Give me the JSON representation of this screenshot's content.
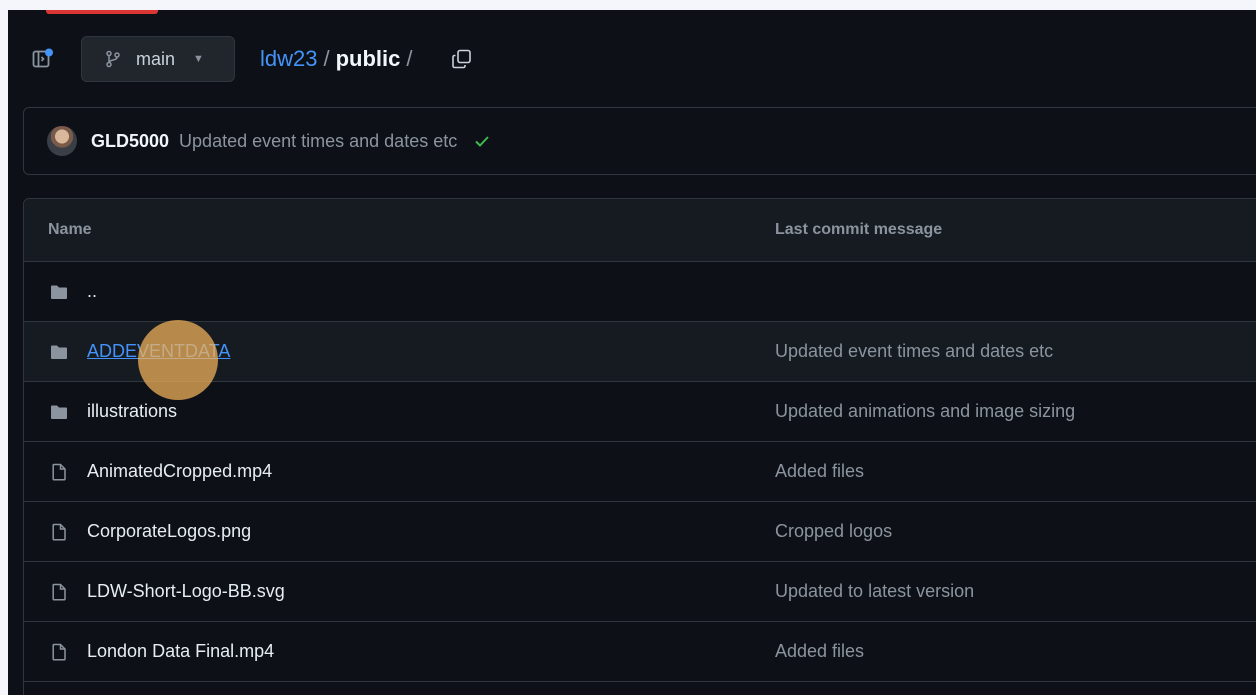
{
  "colors": {
    "background": "#0d1117",
    "border": "#30363d",
    "link": "#4493f8",
    "muted": "#8b949e",
    "text": "#e6edf3",
    "success": "#3fb950",
    "accent_top": "#da3633",
    "click_indicator": "#f5b45a"
  },
  "toolbar": {
    "branch": "main",
    "breadcrumb": {
      "owner": "ldw23",
      "separator": "/",
      "repo": "public",
      "trailing": "/"
    },
    "icons": {
      "sidebar": "sidebar-expand-icon",
      "branch": "git-branch-icon",
      "caret": "caret-down-icon",
      "copy": "copy-icon"
    }
  },
  "commit": {
    "author": "GLD5000",
    "message": "Updated event times and dates etc",
    "status_icon": "check-icon"
  },
  "table": {
    "headers": {
      "name": "Name",
      "message": "Last commit message"
    },
    "rows": [
      {
        "type": "folder",
        "name": "..",
        "message": ""
      },
      {
        "type": "folder",
        "name": "ADDEVENTDATA",
        "message": "Updated event times and dates etc",
        "hovered": true
      },
      {
        "type": "folder",
        "name": "illustrations",
        "message": "Updated animations and image sizing"
      },
      {
        "type": "file",
        "name": "AnimatedCropped.mp4",
        "message": "Added files"
      },
      {
        "type": "file",
        "name": "CorporateLogos.png",
        "message": "Cropped logos"
      },
      {
        "type": "file",
        "name": "LDW-Short-Logo-BB.svg",
        "message": "Updated to latest version"
      },
      {
        "type": "file",
        "name": "London Data Final.mp4",
        "message": "Added files"
      }
    ]
  }
}
